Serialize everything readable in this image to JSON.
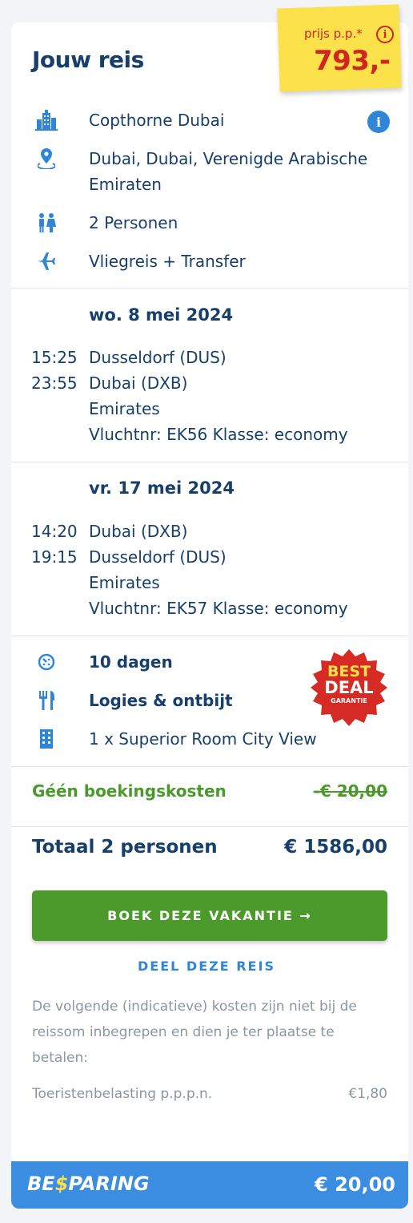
{
  "header": {
    "title": "Jouw reis",
    "price_label": "prijs p.p.*",
    "price_value": "793,-"
  },
  "summary": {
    "hotel": "Copthorne Dubai",
    "location_line1": "Dubai, Dubai, Verenigde Arabische",
    "location_line2": "Emiraten",
    "persons": "2 Personen",
    "travel_type": "Vliegreis + Transfer"
  },
  "outbound": {
    "date": "wo. 8 mei 2024",
    "dep_time": "15:25",
    "dep_airport": "Dusseldorf (DUS)",
    "arr_time": "23:55",
    "arr_airport": "Dubai (DXB)",
    "airline": "Emirates",
    "flight_info": "Vluchtnr: EK56 Klasse: economy"
  },
  "return": {
    "date": "vr. 17 mei 2024",
    "dep_time": "14:20",
    "dep_airport": "Dubai (DXB)",
    "arr_time": "19:15",
    "arr_airport": "Dusseldorf (DUS)",
    "airline": "Emirates",
    "flight_info": "Vluchtnr: EK57 Klasse: economy"
  },
  "stay": {
    "duration": "10 dagen",
    "board": "Logies & ontbijt",
    "room": "1 x Superior Room City View"
  },
  "badge": {
    "line1": "BEST",
    "line2": "DEAL",
    "line3": "GARANTIE"
  },
  "costs": {
    "booking_label": "Géén boekingskosten",
    "booking_old": "-€ 20,00",
    "total_label": "Totaal 2 personen",
    "total_value": "€ 1586,00"
  },
  "actions": {
    "book_label": "BOEK DEZE VAKANTIE →",
    "share_label": "DEEL DEZE REIS"
  },
  "extra": {
    "note": "De volgende (indicatieve) kosten zijn niet bij de reissom inbegrepen en dien je ter plaatse te betalen:",
    "tax_label": "Toeristenbelasting p.p.p.n.",
    "tax_value": "€1,80"
  },
  "savings": {
    "logo_pre": "BE",
    "logo_dollar": "$",
    "logo_post": "PARING",
    "value": "€ 20,00"
  },
  "colors": {
    "primary": "#173f6b",
    "accent_blue": "#2f85d8",
    "green": "#4d9a2c",
    "red": "#d0261e",
    "yellow": "#fce24a"
  }
}
